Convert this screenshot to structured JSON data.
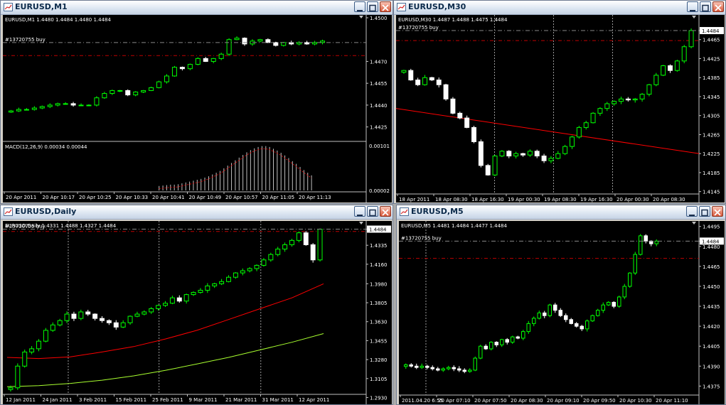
{
  "colors": {
    "background": "#000000",
    "axis": "#c0c0c0",
    "bull": "#00ff00",
    "bear": "#ffffff",
    "grid": "#c0c0c0",
    "order": "#888888",
    "stop": "#c00000",
    "macd_hist": "#c0c0c0",
    "macd_signal": "#ff0000",
    "ma_red": "#ff0000",
    "ma_green": "#a8ff2f"
  },
  "windows": [
    {
      "id": "m1",
      "title": "EURUSD,M1",
      "icons": [
        "chart-window-icon",
        "minimize-icon",
        "maximize-icon",
        "close-icon"
      ]
    },
    {
      "id": "m30",
      "title": "EURUSD,M30",
      "icons": [
        "chart-window-icon",
        "minimize-icon",
        "maximize-icon",
        "close-icon"
      ]
    },
    {
      "id": "daily",
      "title": "EURUSD,Daily",
      "icons": [
        "chart-window-icon",
        "minimize-icon",
        "maximize-icon",
        "close-icon"
      ]
    },
    {
      "id": "m5",
      "title": "EURUSD,M5",
      "icons": [
        "chart-window-icon",
        "minimize-icon",
        "maximize-icon",
        "close-icon"
      ]
    }
  ],
  "chart_data": [
    {
      "type": "candlestick",
      "window": "m1",
      "symbol_info": "EURUSD,M1  1.4480 1.4484 1.4480 1.4484",
      "order_label": "#13720755 buy",
      "current_price": "1.4484",
      "order_price": 1.4483,
      "stop_price": 1.4474,
      "ylim": [
        1.4418,
        1.45
      ],
      "y_ticks": [
        "1.4500",
        "1.4470",
        "1.4455",
        "1.4440",
        "1.4425"
      ],
      "y_tick_values": [
        1.45,
        1.447,
        1.4455,
        1.444,
        1.4425
      ],
      "x_ticks": [
        "20 Apr 2011",
        "20 Apr 10:17",
        "20 Apr 10:25",
        "20 Apr 10:33",
        "20 Apr 10:41",
        "20 Apr 10:49",
        "20 Apr 10:57",
        "20 Apr 11:05",
        "20 Apr 11:13"
      ],
      "close_path": [
        1.4436,
        1.4437,
        1.4437,
        1.4438,
        1.4439,
        1.444,
        1.4441,
        1.4441,
        1.444,
        1.444,
        1.444,
        1.4445,
        1.4448,
        1.445,
        1.445,
        1.4447,
        1.4449,
        1.445,
        1.4452,
        1.4456,
        1.446,
        1.4466,
        1.4465,
        1.4468,
        1.4472,
        1.447,
        1.4472,
        1.4475,
        1.4485,
        1.4486,
        1.4482,
        1.4484,
        1.4485,
        1.4483,
        1.4481,
        1.4483,
        1.4482,
        1.4483,
        1.4482,
        1.4483,
        1.4484
      ],
      "indicator": {
        "label": "MACD(12,26,9) 0.00034 0.00044",
        "ylim": [
          0,
          0.00101
        ],
        "y_ticks": [
          "0.00101",
          "0.00002"
        ],
        "hist": [
          0.0001,
          0.00011,
          0.00012,
          0.00013,
          0.00013,
          0.00014,
          0.00016,
          0.00018,
          0.0002,
          0.00022,
          0.00024,
          0.00026,
          0.00029,
          0.00032,
          0.00036,
          0.0004,
          0.00044,
          0.0005,
          0.00056,
          0.00062,
          0.00068,
          0.00074,
          0.0008,
          0.00086,
          0.00091,
          0.00095,
          0.00098,
          0.001,
          0.001,
          0.00098,
          0.00094,
          0.0009,
          0.00085,
          0.00079,
          0.00073,
          0.00066,
          0.0006,
          0.00053,
          0.00046,
          0.0004,
          0.00034
        ]
      }
    },
    {
      "type": "candlestick",
      "window": "m30",
      "symbol_info": "EURUSD,M30  1.4487 1.4488 1.4475 1.4484",
      "order_label": "#13720755 buy",
      "current_price": "1.4484",
      "order_price": 1.4484,
      "stop_price": 1.4463,
      "ylim": [
        1.414,
        1.4505
      ],
      "y_ticks": [
        "1.4484",
        "1.4465",
        "1.4425",
        "1.4385",
        "1.4345",
        "1.4305",
        "1.4265",
        "1.4225",
        "1.4185",
        "1.4145"
      ],
      "y_tick_values": [
        1.4484,
        1.4465,
        1.4425,
        1.4385,
        1.4345,
        1.4305,
        1.4265,
        1.4225,
        1.4185,
        1.4145
      ],
      "x_ticks": [
        "18 Apr 2011",
        "18 Apr 08:30",
        "18 Apr 16:30",
        "19 Apr 00:30",
        "19 Apr 08:30",
        "19 Apr 16:30",
        "20 Apr 00:30",
        "20 Apr 08:30"
      ],
      "close_path": [
        1.44,
        1.438,
        1.437,
        1.4385,
        1.438,
        1.437,
        1.434,
        1.431,
        1.43,
        1.428,
        1.425,
        1.42,
        1.418,
        1.422,
        1.423,
        1.422,
        1.4225,
        1.4222,
        1.423,
        1.422,
        1.421,
        1.4215,
        1.4225,
        1.424,
        1.426,
        1.428,
        1.429,
        1.431,
        1.432,
        1.433,
        1.4335,
        1.434,
        1.4338,
        1.434,
        1.435,
        1.437,
        1.439,
        1.441,
        1.44,
        1.442,
        1.445,
        1.4484
      ],
      "ma_line": {
        "color_key": "ma_red",
        "start": 1.432,
        "end": 1.4225
      }
    },
    {
      "type": "candlestick",
      "window": "daily",
      "symbol_info": "EURUSD,Daily  1.4331 1.4488 1.4327 1.4484",
      "order_label": "#13720755 buy",
      "current_price": "1.4484",
      "order_price": 1.4484,
      "stop_price": 1.4463,
      "ylim": [
        1.292,
        1.452
      ],
      "y_ticks": [
        "1.4484",
        "1.4335",
        "1.4160",
        "1.3980",
        "1.3805",
        "1.3630",
        "1.3455",
        "1.3280",
        "1.3105",
        "1.2930"
      ],
      "y_tick_values": [
        1.4484,
        1.4335,
        1.416,
        1.398,
        1.3805,
        1.363,
        1.3455,
        1.328,
        1.3105,
        1.293
      ],
      "x_ticks": [
        "12 Jan 2011",
        "24 Jan 2011",
        "3 Feb 2011",
        "15 Feb 2011",
        "25 Feb 2011",
        "9 Mar 2011",
        "21 Mar 2011",
        "31 Mar 2011",
        "12 Apr 2011"
      ],
      "close_path": [
        1.302,
        1.322,
        1.335,
        1.338,
        1.345,
        1.355,
        1.36,
        1.364,
        1.37,
        1.366,
        1.372,
        1.37,
        1.366,
        1.364,
        1.362,
        1.358,
        1.362,
        1.368,
        1.37,
        1.372,
        1.375,
        1.378,
        1.38,
        1.385,
        1.382,
        1.388,
        1.39,
        1.392,
        1.396,
        1.398,
        1.4,
        1.404,
        1.408,
        1.41,
        1.412,
        1.415,
        1.42,
        1.425,
        1.43,
        1.434,
        1.438,
        1.445,
        1.434,
        1.42,
        1.4484
      ],
      "ma_lines": [
        {
          "color_key": "ma_red",
          "values": [
            1.33,
            1.329,
            1.3305,
            1.335,
            1.34,
            1.347,
            1.355,
            1.365,
            1.375,
            1.385,
            1.398
          ]
        },
        {
          "color_key": "ma_green",
          "values": [
            1.303,
            1.304,
            1.306,
            1.309,
            1.313,
            1.318,
            1.324,
            1.33,
            1.337,
            1.344,
            1.352
          ]
        }
      ]
    },
    {
      "type": "candlestick",
      "window": "m5",
      "symbol_info": "EURUSD,M5  1.4481 1.4484 1.4477 1.4484",
      "order_label": "#13720755 buy",
      "current_price": "1.4484",
      "order_price": 1.4484,
      "stop_price": 1.4471,
      "ylim": [
        1.4372,
        1.4497
      ],
      "y_ticks": [
        "1.4495",
        "1.4484",
        "1.4480",
        "1.4465",
        "1.4450",
        "1.4435",
        "1.4420",
        "1.4405",
        "1.4390",
        "1.4375"
      ],
      "y_tick_values": [
        1.4495,
        1.4484,
        1.448,
        1.4465,
        1.445,
        1.4435,
        1.442,
        1.4405,
        1.439,
        1.4375
      ],
      "x_ticks": [
        "2011.04.20 6:55",
        "20 Apr 07:10",
        "20 Apr 07:50",
        "20 Apr 08:30",
        "20 Apr 09:10",
        "20 Apr 09:50",
        "20 Apr 10:30",
        "20 Apr 11:10"
      ],
      "close_path": [
        1.4391,
        1.439,
        1.4389,
        1.439,
        1.4389,
        1.4388,
        1.4387,
        1.4388,
        1.4389,
        1.4388,
        1.4387,
        1.4386,
        1.4387,
        1.4396,
        1.4405,
        1.4403,
        1.4408,
        1.4406,
        1.441,
        1.4408,
        1.4412,
        1.4411,
        1.4416,
        1.4422,
        1.4426,
        1.443,
        1.4428,
        1.4436,
        1.4432,
        1.4428,
        1.4425,
        1.4422,
        1.442,
        1.4418,
        1.4424,
        1.4428,
        1.4432,
        1.4436,
        1.4438,
        1.4435,
        1.4442,
        1.445,
        1.446,
        1.4474,
        1.4488,
        1.4484,
        1.4482,
        1.4484
      ]
    }
  ]
}
